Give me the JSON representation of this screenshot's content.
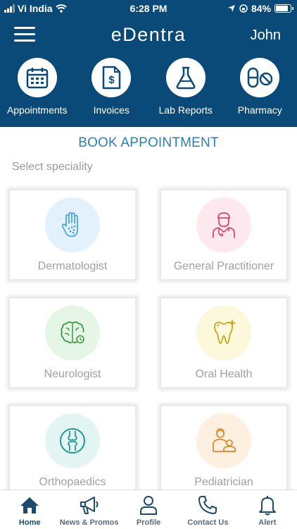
{
  "status_bar": {
    "carrier": "Vi India",
    "time": "6:28 PM",
    "battery": "84%",
    "battery_level": 0.84
  },
  "header": {
    "logo": "eDentra",
    "user_name": "John"
  },
  "quick_nav": [
    {
      "label": "Appointments",
      "icon": "calendar-icon"
    },
    {
      "label": "Invoices",
      "icon": "invoice-icon"
    },
    {
      "label": "Lab Reports",
      "icon": "flask-icon"
    },
    {
      "label": "Pharmacy",
      "icon": "pills-icon"
    }
  ],
  "main": {
    "title": "BOOK APPOINTMENT",
    "select_label": "Select speciality",
    "specialities": [
      {
        "label": "Dermatologist",
        "icon": "hand-icon",
        "bg": "#e3f1fc",
        "color": "#4fa3e0"
      },
      {
        "label": "General Practitioner",
        "icon": "doctor-icon",
        "bg": "#fde8ee",
        "color": "#d6456e"
      },
      {
        "label": "Neurologist",
        "icon": "brain-icon",
        "bg": "#e6f6e6",
        "color": "#3a9a4a"
      },
      {
        "label": "Oral Health",
        "icon": "tooth-icon",
        "bg": "#fbf8dc",
        "color": "#c9a820"
      },
      {
        "label": "Orthopaedics",
        "icon": "bone-joint-icon",
        "bg": "#e2f5f3",
        "color": "#23988f"
      },
      {
        "label": "Pediatrician",
        "icon": "parent-child-icon",
        "bg": "#fdf0e0",
        "color": "#e08a2c"
      }
    ]
  },
  "bottom_nav": [
    {
      "label": "Home",
      "icon": "home-icon"
    },
    {
      "label": "News & Promos",
      "icon": "megaphone-icon"
    },
    {
      "label": "Profile",
      "icon": "user-icon"
    },
    {
      "label": "Contact Us",
      "icon": "phone-icon"
    },
    {
      "label": "Alert",
      "icon": "bell-icon"
    }
  ],
  "colors": {
    "header_bg": "#0a4a78",
    "accent": "#2b7fb3",
    "nav_active": "#1a4a70",
    "nav_inactive": "#5a6a78"
  }
}
